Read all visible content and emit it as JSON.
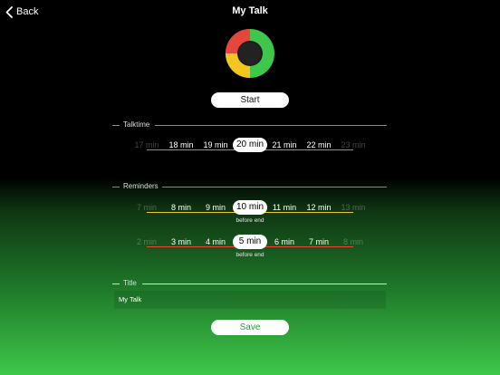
{
  "nav": {
    "back_label": "Back",
    "title": "My Talk"
  },
  "start_label": "Start",
  "save_label": "Save",
  "talktime": {
    "label": "Talktime",
    "items": [
      "17 min",
      "18 min",
      "19 min",
      "20 min",
      "21 min",
      "22 min",
      "23 min"
    ],
    "selected_index": 3
  },
  "reminders": {
    "label": "Reminders",
    "first": {
      "items": [
        "7 min",
        "8 min",
        "9 min",
        "10 min",
        "11 min",
        "12 min",
        "13 min"
      ],
      "selected_index": 3,
      "caption": "before end"
    },
    "second": {
      "items": [
        "2 min",
        "3 min",
        "4 min",
        "5 min",
        "6 min",
        "7 min",
        "8 min"
      ],
      "selected_index": 3,
      "caption": "before end"
    }
  },
  "title_section": {
    "label": "Title",
    "value": "My Talk"
  },
  "colors": {
    "green": "#3ec74a",
    "yellow": "#f3c51f",
    "red": "#e8453c",
    "save_text": "#2d9a3a"
  }
}
